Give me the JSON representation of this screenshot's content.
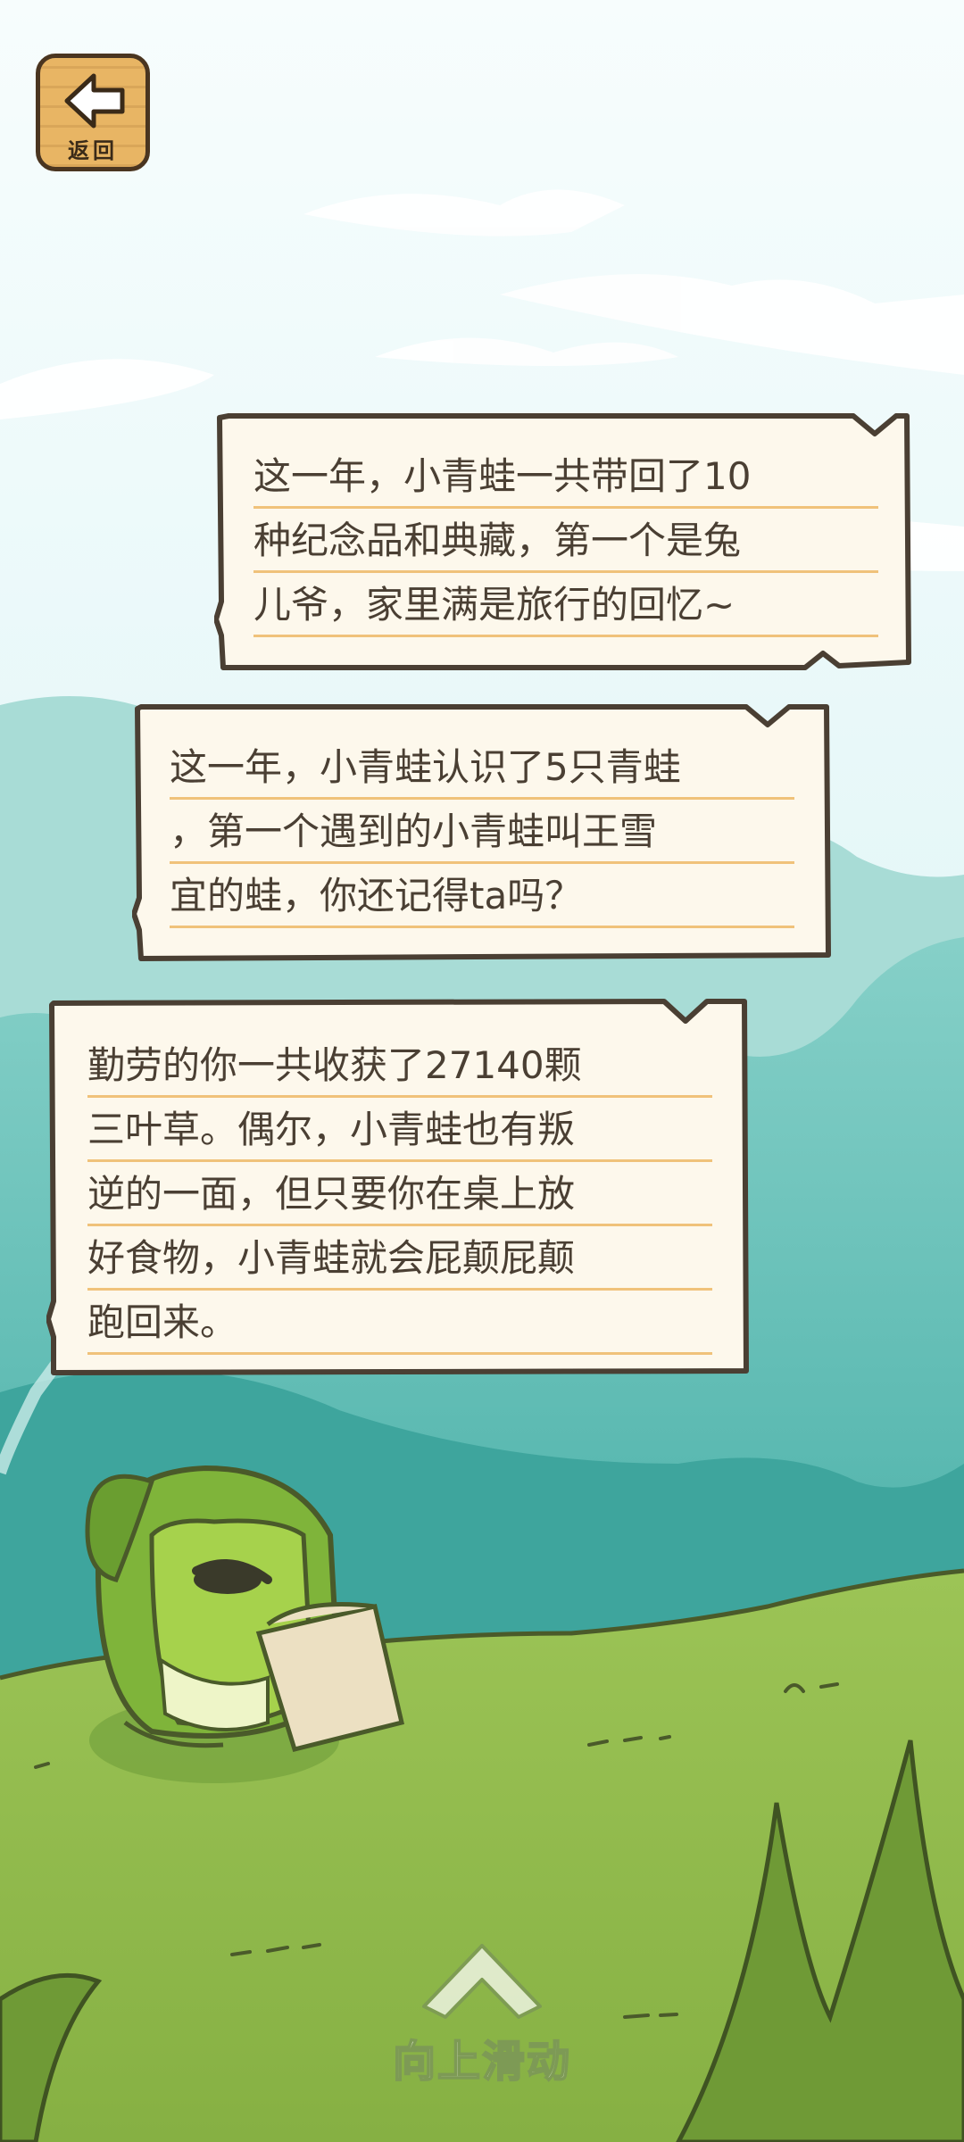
{
  "header": {
    "back_label": "返回",
    "back_icon": "arrow-left-icon"
  },
  "messages": [
    {
      "lines": [
        "这一年，小青蛙一共带回了10",
        "种纪念品和典藏，第一个是兔",
        "儿爷，家里满是旅行的回忆~"
      ]
    },
    {
      "lines": [
        "这一年，小青蛙认识了5只青蛙",
        "，第一个遇到的小青蛙叫王雪",
        "宜的蛙，你还记得ta吗？"
      ]
    },
    {
      "lines": [
        "勤劳的你一共收获了27140颗",
        "三叶草。偶尔，小青蛙也有叛",
        "逆的一面，但只要你在桌上放",
        "好食物，小青蛙就会屁颠屁颠",
        "跑回来。"
      ]
    }
  ],
  "footer": {
    "swipe_label": "向上滑动",
    "swipe_icon": "chevron-up-icon"
  },
  "colors": {
    "sky": "#e6f8fa",
    "mountain": "#5fbfb7",
    "grass": "#8fb84a",
    "frog": "#8cc43c",
    "bubble_bg": "#fdf8ec",
    "bubble_border": "#4a3f33",
    "underline": "#f0c27a",
    "wood": "#e8b564"
  }
}
